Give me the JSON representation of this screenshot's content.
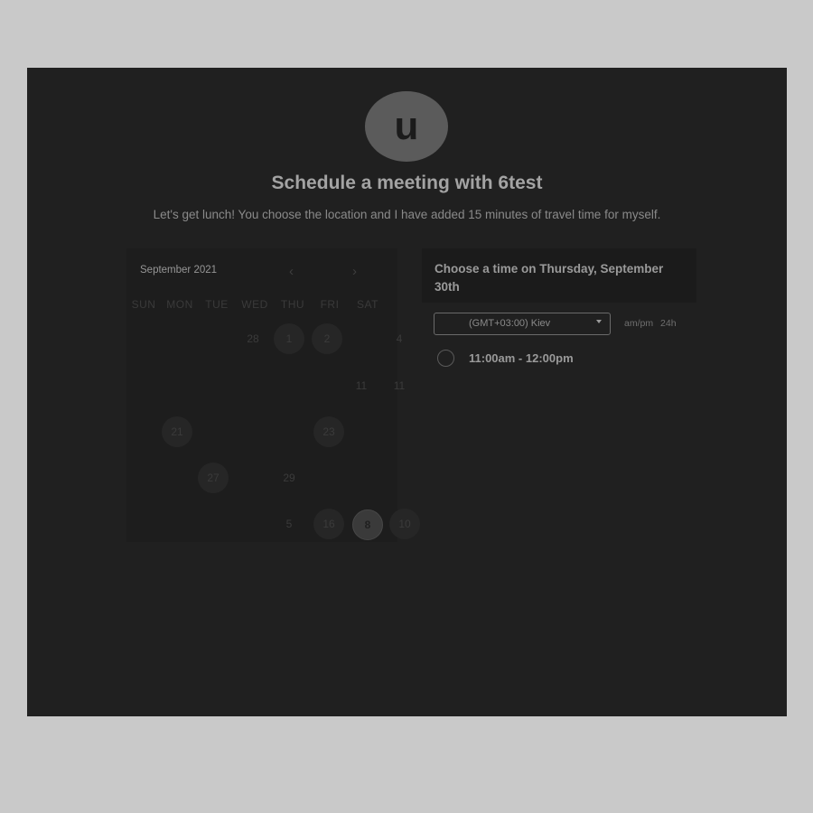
{
  "host": {
    "avatar_letter": "u"
  },
  "header": {
    "title": "Schedule a meeting with 6test",
    "subtitle": "Let's get lunch! You choose the location and I have added 15 minutes of travel time for myself."
  },
  "calendar": {
    "month_label": "September 2021",
    "prev_icon": "chevron-left-icon",
    "next_icon": "chevron-right-icon",
    "weekdays": [
      "SUN",
      "MON",
      "TUE",
      "WED",
      "THU",
      "FRI",
      "SAT"
    ],
    "days": {
      "d28": "28",
      "d1": "1",
      "d2": "2",
      "d4": "4",
      "d11": "11",
      "d21": "21",
      "d23": "23",
      "d27": "27",
      "d29": "29",
      "d5": "5",
      "d16": "16",
      "d8": "8",
      "d10": "10"
    }
  },
  "time_panel": {
    "heading": "Choose a time on Thursday, September 30th",
    "timezone": "(GMT+03:00) Kiev",
    "format_ampm": "am/pm",
    "format_24h": "24h",
    "slots": [
      {
        "label": "11:00am - 12:00pm"
      }
    ]
  },
  "colors": {
    "panel_bg": "#202020",
    "page_bg": "#c9c9c9",
    "text_primary": "#a3a3a3"
  }
}
